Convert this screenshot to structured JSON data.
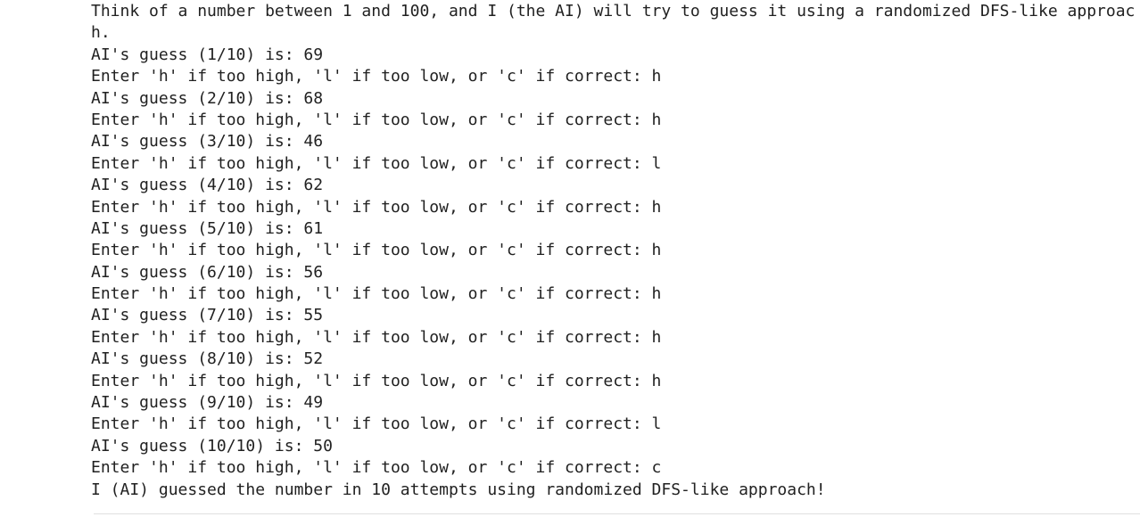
{
  "output": {
    "lines": [
      "Think of a number between 1 and 100, and I (the AI) will try to guess it using a randomized DFS-like approac",
      "h.",
      "AI's guess (1/10) is: 69",
      "Enter 'h' if too high, 'l' if too low, or 'c' if correct: h",
      "AI's guess (2/10) is: 68",
      "Enter 'h' if too high, 'l' if too low, or 'c' if correct: h",
      "AI's guess (3/10) is: 46",
      "Enter 'h' if too high, 'l' if too low, or 'c' if correct: l",
      "AI's guess (4/10) is: 62",
      "Enter 'h' if too high, 'l' if too low, or 'c' if correct: h",
      "AI's guess (5/10) is: 61",
      "Enter 'h' if too high, 'l' if too low, or 'c' if correct: h",
      "AI's guess (6/10) is: 56",
      "Enter 'h' if too high, 'l' if too low, or 'c' if correct: h",
      "AI's guess (7/10) is: 55",
      "Enter 'h' if too high, 'l' if too low, or 'c' if correct: h",
      "AI's guess (8/10) is: 52",
      "Enter 'h' if too high, 'l' if too low, or 'c' if correct: h",
      "AI's guess (9/10) is: 49",
      "Enter 'h' if too high, 'l' if too low, or 'c' if correct: l",
      "AI's guess (10/10) is: 50",
      "Enter 'h' if too high, 'l' if too low, or 'c' if correct: c",
      "I (AI) guessed the number in 10 attempts using randomized DFS-like approach!"
    ]
  }
}
